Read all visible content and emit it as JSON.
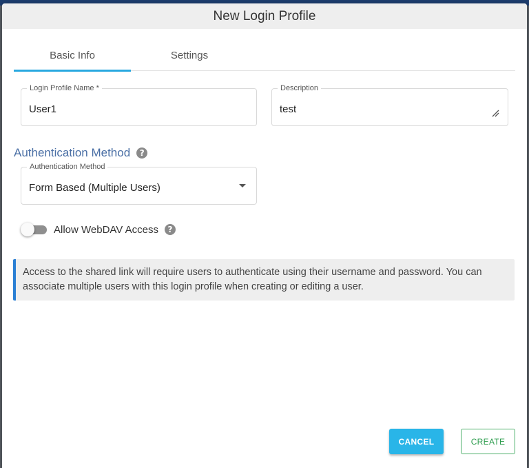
{
  "dialog": {
    "title": "New Login Profile"
  },
  "tabs": [
    {
      "label": "Basic Info",
      "active": true
    },
    {
      "label": "Settings",
      "active": false
    }
  ],
  "fields": {
    "login_profile_name": {
      "label": "Login Profile Name *",
      "value": "User1"
    },
    "description": {
      "label": "Description",
      "value": "test"
    }
  },
  "auth_section": {
    "title": "Authentication Method",
    "help_icon": "question-circle-icon",
    "select": {
      "label": "Authentication Method",
      "value": "Form Based (Multiple Users)"
    }
  },
  "webdav": {
    "label": "Allow WebDAV Access",
    "enabled": false
  },
  "info_text": "Access to the shared link will require users to authenticate using their username and password. You can associate multiple users with this login profile when creating or editing a user.",
  "buttons": {
    "cancel": "CANCEL",
    "create": "CREATE"
  },
  "colors": {
    "accent": "#29a9e0",
    "section_title": "#4a6fa5",
    "info_border": "#2a7fd4",
    "cancel_bg": "#29b5e8",
    "create_green": "#2e9d4e"
  }
}
